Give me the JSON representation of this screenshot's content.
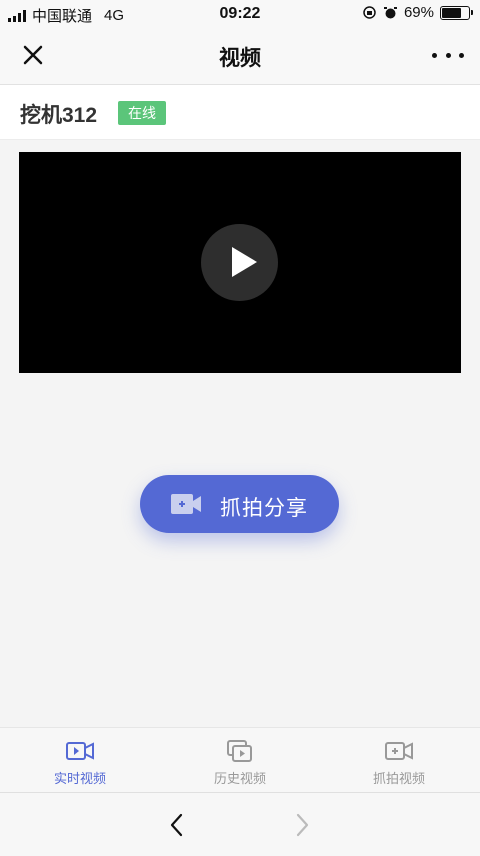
{
  "status_bar": {
    "carrier": "中国联通",
    "network": "4G",
    "time": "09:22",
    "battery": "69%",
    "battery_level": 0.69
  },
  "nav": {
    "title": "视频",
    "close_icon": "close-icon",
    "more_icon": "more-dots-icon"
  },
  "device": {
    "name": "挖机312",
    "status": "在线",
    "status_color": "#5bc57a"
  },
  "player": {
    "play_icon": "play-icon"
  },
  "capture_share": {
    "label": "抓拍分享",
    "icon": "camera-capture-icon",
    "color": "#5469d4"
  },
  "tabs": [
    {
      "label": "实时视频",
      "icon": "live-video-icon",
      "active": true
    },
    {
      "label": "历史视频",
      "icon": "history-video-icon",
      "active": false
    },
    {
      "label": "抓拍视频",
      "icon": "capture-video-icon",
      "active": false
    }
  ],
  "browser": {
    "back_icon": "chevron-left-icon",
    "forward_icon": "chevron-right-icon"
  }
}
